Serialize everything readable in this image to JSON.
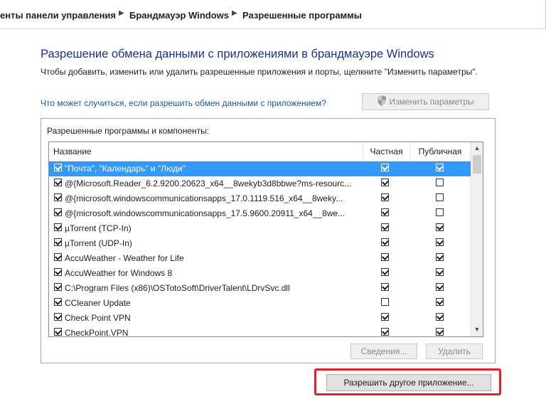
{
  "breadcrumb": {
    "items": [
      "енты панели управления",
      "Брандмауэр Windows",
      "Разрешенные программы"
    ],
    "separator": "▶"
  },
  "page": {
    "title": "Разрешение обмена данными с приложениями в брандмауэре Windows",
    "description": "Чтобы добавить, изменить или удалить разрешенные приложения и порты, щелкните \"Изменить параметры\".",
    "risk_link": "Что может случиться, если разрешить обмен данными с приложением?",
    "change_settings_button": "Изменить параметры",
    "change_settings_icon": "shield-icon"
  },
  "allowed_list": {
    "group_label": "Разрешенные программы и компоненты:",
    "columns": {
      "name": "Название",
      "private": "Частная",
      "public": "Публичная"
    },
    "rows": [
      {
        "name": "\"Почта\", \"Календарь\" и \"Люди\"",
        "enabled": true,
        "private": true,
        "public": true,
        "selected": true
      },
      {
        "name": "@{Microsoft.Reader_6.2.9200.20623_x64__8wekyb3d8bbwe?ms-resourc...",
        "enabled": true,
        "private": true,
        "public": false,
        "selected": false
      },
      {
        "name": "@{microsoft.windowscommunicationsapps_17.0.1119.516_x64__8weky...",
        "enabled": true,
        "private": true,
        "public": false,
        "selected": false
      },
      {
        "name": "@{microsoft.windowscommunicationsapps_17.5.9600.20911_x64__8we...",
        "enabled": true,
        "private": true,
        "public": false,
        "selected": false
      },
      {
        "name": "µTorrent (TCP-In)",
        "enabled": true,
        "private": true,
        "public": true,
        "selected": false
      },
      {
        "name": "µTorrent (UDP-In)",
        "enabled": true,
        "private": true,
        "public": true,
        "selected": false
      },
      {
        "name": "AccuWeather - Weather for Life",
        "enabled": true,
        "private": true,
        "public": true,
        "selected": false
      },
      {
        "name": "AccuWeather for Windows 8",
        "enabled": true,
        "private": true,
        "public": true,
        "selected": false
      },
      {
        "name": "C:\\Program Files (x86)\\OSTotoSoft\\DriverTalent\\LDrvSvc.dll",
        "enabled": true,
        "private": true,
        "public": true,
        "selected": false
      },
      {
        "name": "CCleaner Update",
        "enabled": true,
        "private": false,
        "public": true,
        "selected": false
      },
      {
        "name": "Check Point VPN",
        "enabled": true,
        "private": true,
        "public": true,
        "selected": false
      },
      {
        "name": "CheckPoint.VPN",
        "enabled": true,
        "private": true,
        "public": true,
        "selected": false
      }
    ],
    "details_button": "Сведения...",
    "remove_button": "Удалить"
  },
  "allow_other_button": "Разрешить другое приложение...",
  "colors": {
    "title": "#1e3287",
    "link": "#1a56b0",
    "selection": "#3399ff",
    "highlight": "#e0202a"
  }
}
